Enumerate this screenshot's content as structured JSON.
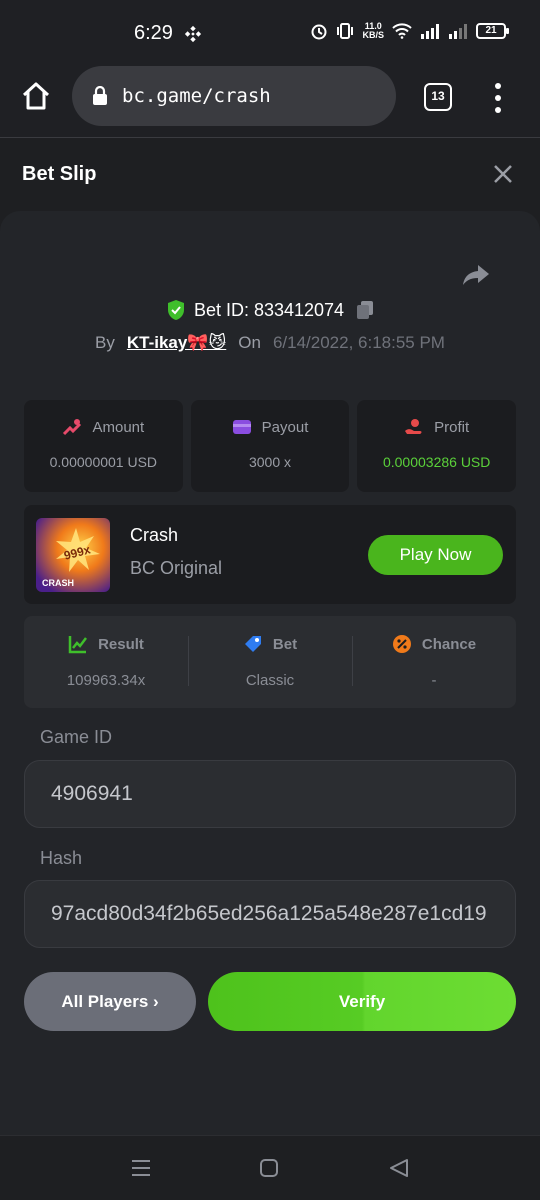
{
  "status_bar": {
    "time": "6:29",
    "net_speed_value": "11.0",
    "net_speed_unit": "KB/S",
    "battery": "21"
  },
  "browser": {
    "url": "bc.game/crash",
    "tab_count": "13"
  },
  "slip": {
    "title": "Bet Slip",
    "bet_id": "Bet ID: 833412074",
    "by_label": "By",
    "user": "KT-ikay🎀😼",
    "on_label": "On",
    "date": "6/14/2022, 6:18:55 PM"
  },
  "stats": [
    {
      "label": "Amount",
      "value": "0.00000001 USD"
    },
    {
      "label": "Payout",
      "value": "3000 x"
    },
    {
      "label": "Profit",
      "value": "0.00003286 USD"
    }
  ],
  "game": {
    "name": "Crash",
    "subtitle": "BC Original",
    "thumb_badge": "999x",
    "thumb_label": "CRASH",
    "play_label": "Play Now"
  },
  "results": [
    {
      "label": "Result",
      "value": "109963.34x"
    },
    {
      "label": "Bet",
      "value": "Classic"
    },
    {
      "label": "Chance",
      "value": "-"
    }
  ],
  "fields": {
    "game_id_label": "Game ID",
    "game_id_value": "4906941",
    "hash_label": "Hash",
    "hash_value": "97acd80d34f2b65ed256a125a548e287e1cd19"
  },
  "actions": {
    "all_players": "All Players ›",
    "verify": "Verify"
  },
  "colors": {
    "accent_green": "#4ab51d",
    "profit_green": "#5bd13a",
    "background": "#1e1f22",
    "panel": "#232529"
  }
}
